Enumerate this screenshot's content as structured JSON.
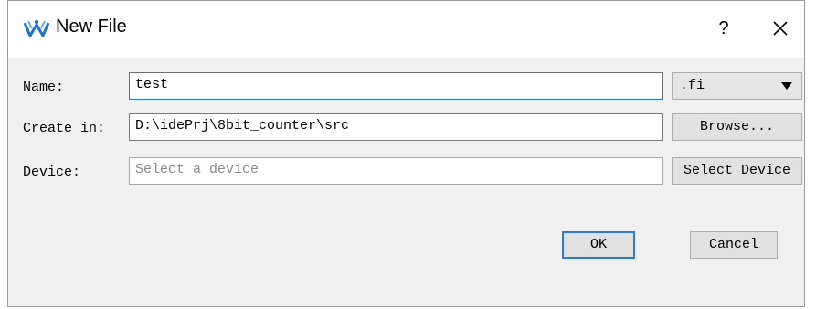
{
  "window": {
    "title": "New File",
    "help_label": "?",
    "icons": {
      "app": "gowin-logo-icon",
      "close": "close-icon"
    }
  },
  "form": {
    "name": {
      "label": "Name:",
      "value": "test"
    },
    "extension": {
      "selected": ".fi"
    },
    "create_in": {
      "label": "Create in:",
      "value": "D:\\idePrj\\8bit_counter\\src",
      "browse_label": "Browse..."
    },
    "device": {
      "label": "Device:",
      "placeholder": "Select a device",
      "select_label": "Select Device"
    }
  },
  "actions": {
    "ok_label": "OK",
    "cancel_label": "Cancel"
  },
  "colors": {
    "accent": "#2f7ad6",
    "logo": "#1e73c8"
  }
}
